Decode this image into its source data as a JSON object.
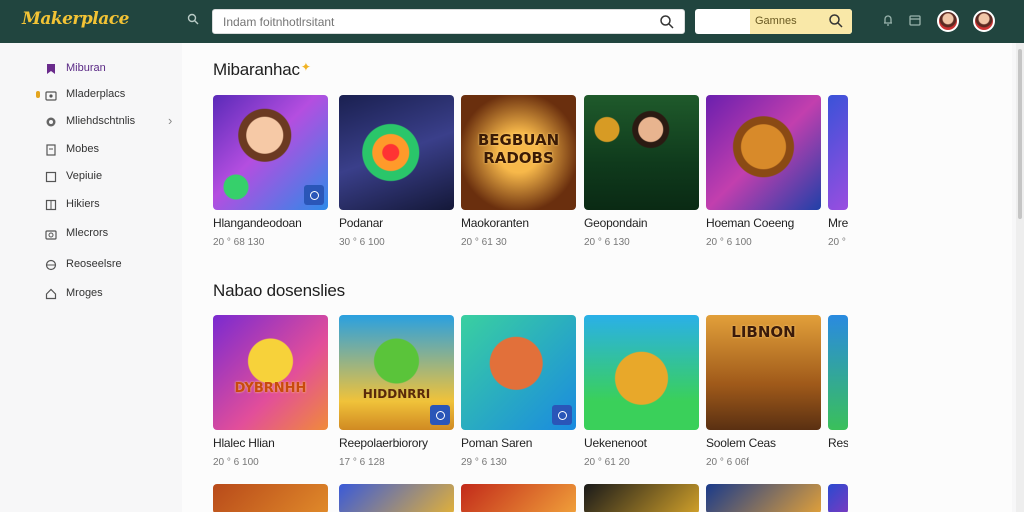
{
  "header": {
    "logo": "Makerplace",
    "search_placeholder": "Indam foitnhotlrsitant",
    "games_label": "Gamnes"
  },
  "sidebar": {
    "items": [
      {
        "label": "Miburan",
        "icon": "bookmark-icon",
        "active": true
      },
      {
        "label": "Mladerplacs",
        "icon": "store-icon",
        "active": false
      },
      {
        "label": "Mliehdschtnlis",
        "icon": "puzzle-icon",
        "active": false,
        "expandable": true
      },
      {
        "label": "Mobes",
        "icon": "document-icon",
        "active": false
      },
      {
        "label": "Vepiuie",
        "icon": "square-icon",
        "active": false
      },
      {
        "label": "Hikiers",
        "icon": "grid-icon",
        "active": false
      },
      {
        "label": "Mlecrors",
        "icon": "camera-icon",
        "active": false
      },
      {
        "label": "Reoseelsre",
        "icon": "globe-icon",
        "active": false
      },
      {
        "label": "Mroges",
        "icon": "home-icon",
        "active": false
      }
    ]
  },
  "sections": [
    {
      "title": "Mibaranhac",
      "cards": [
        {
          "title": "Hlangandeodoan",
          "meta": "20 ° 68 130",
          "badge": true
        },
        {
          "title": "Podanar",
          "meta": "30 ° 6 100",
          "badge": false
        },
        {
          "title": "Maokoranten",
          "meta": "20 ° 61 30",
          "badge": false,
          "art_text": "BEGBUAN RADOBS"
        },
        {
          "title": "Geopondain",
          "meta": "20 ° 6 130",
          "badge": false
        },
        {
          "title": "Hoeman Coeeng",
          "meta": "20 ° 6 100",
          "badge": false
        },
        {
          "title": "Mre",
          "meta": "20 °",
          "badge": false
        }
      ]
    },
    {
      "title": "Nabao dosenslies",
      "cards": [
        {
          "title": "Hlalec Hlian",
          "meta": "20 ° 6 100",
          "badge": false,
          "art_text": "DYBRNHH"
        },
        {
          "title": "Reepolaerbiorory",
          "meta": "17 ° 6 128",
          "badge": true,
          "art_text": "HIDDNRRI"
        },
        {
          "title": "Poman Saren",
          "meta": "29 ° 6 130",
          "badge": true
        },
        {
          "title": "Uekenenoot",
          "meta": "20 ° 61 20",
          "badge": false
        },
        {
          "title": "Soolem Ceas",
          "meta": "20 ° 6 06f",
          "badge": false,
          "art_text": "LIBNON"
        },
        {
          "title": "Res",
          "meta": "",
          "badge": false
        }
      ]
    }
  ]
}
